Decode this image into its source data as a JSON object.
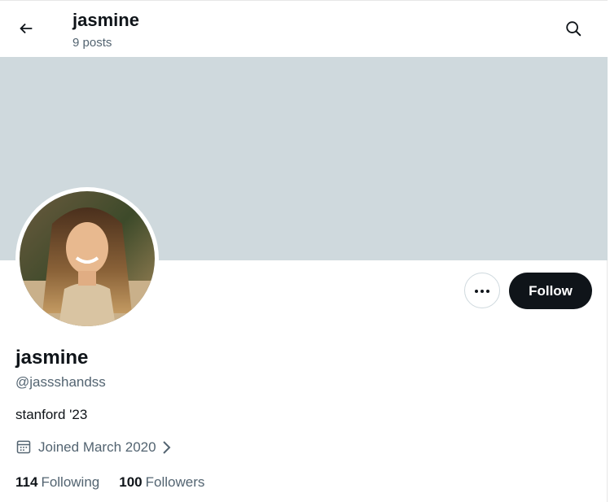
{
  "header": {
    "title": "jasmine",
    "post_count": "9 posts"
  },
  "profile": {
    "name": "jasmine",
    "handle": "@jassshandss",
    "bio": "stanford '23",
    "joined": "Joined March 2020"
  },
  "actions": {
    "follow_label": "Follow"
  },
  "stats": {
    "following_count": "114",
    "following_label": "Following",
    "followers_count": "100",
    "followers_label": "Followers"
  },
  "colors": {
    "banner": "#cfd9dd",
    "text_primary": "#0f1419",
    "text_secondary": "#536471",
    "button_dark": "#0f1419"
  },
  "icons": {
    "back": "arrow-left-icon",
    "search": "search-icon",
    "more": "more-dots-icon",
    "calendar": "calendar-icon",
    "chevron": "chevron-right-icon"
  }
}
